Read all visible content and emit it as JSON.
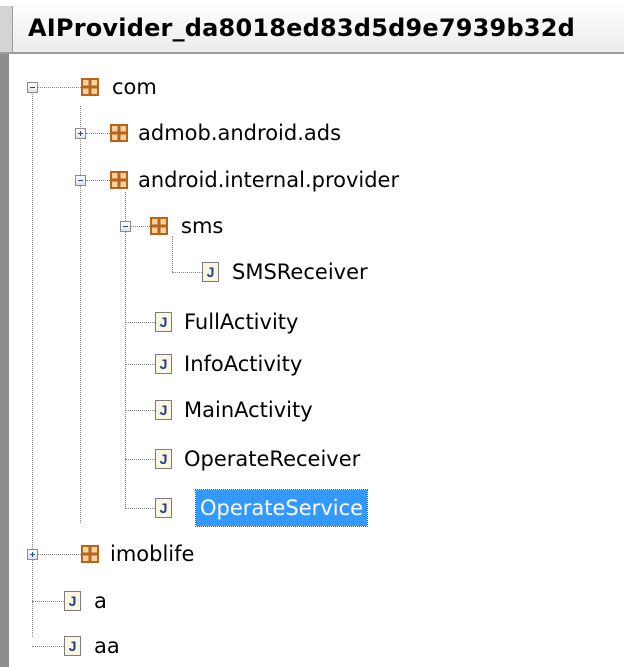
{
  "window": {
    "title": "AIProvider_da8018ed83d5d9e7939b32d"
  },
  "tree": {
    "com": "com",
    "admob": "admob.android.ads",
    "internal": "android.internal.provider",
    "sms": "sms",
    "sms_receiver": "SMSReceiver",
    "full_activity": "FullActivity",
    "info_activity": "InfoActivity",
    "main_activity": "MainActivity",
    "operate_receiver": "OperateReceiver",
    "operate_service": "OperateService",
    "imoblife": "imoblife",
    "a": "a",
    "aa": "aa"
  },
  "icons": {
    "package": "package-icon",
    "java_file": "java-file-icon",
    "expand": "expand-plus-icon",
    "collapse": "collapse-minus-icon"
  },
  "colors": {
    "selection": "#3399ff",
    "java_letter": "#1e3e8e",
    "package": "#b8651b"
  },
  "java_letter": "J"
}
